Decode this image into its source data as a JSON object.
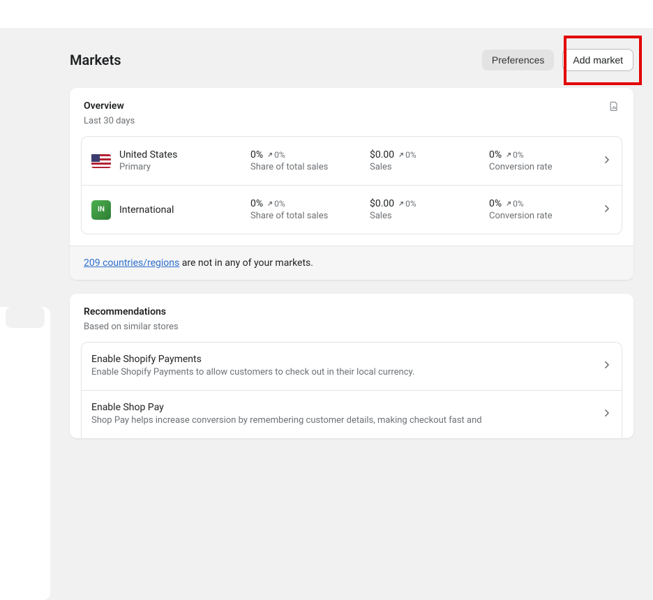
{
  "header": {
    "title": "Markets",
    "preferences_label": "Preferences",
    "add_market_label": "Add market"
  },
  "overview": {
    "title": "Overview",
    "subtitle": "Last 30 days",
    "in_badge": "IN",
    "rows": [
      {
        "name": "United States",
        "sub": "Primary",
        "share": "0%",
        "share_change": "0%",
        "share_label": "Share of total sales",
        "sales": "$0.00",
        "sales_change": "0%",
        "sales_label": "Sales",
        "conv": "0%",
        "conv_change": "0%",
        "conv_label": "Conversion rate"
      },
      {
        "name": "International",
        "sub": "",
        "share": "0%",
        "share_change": "0%",
        "share_label": "Share of total sales",
        "sales": "$0.00",
        "sales_change": "0%",
        "sales_label": "Sales",
        "conv": "0%",
        "conv_change": "0%",
        "conv_label": "Conversion rate"
      }
    ],
    "footer_link": "209 countries/regions",
    "footer_suffix": " are not in any of your markets."
  },
  "recommendations": {
    "title": "Recommendations",
    "subtitle": "Based on similar stores",
    "items": [
      {
        "title": "Enable Shopify Payments",
        "desc": "Enable Shopify Payments to allow customers to check out in their local currency."
      },
      {
        "title": "Enable Shop Pay",
        "desc": "Shop Pay helps increase conversion by remembering customer details, making checkout fast and"
      }
    ]
  }
}
